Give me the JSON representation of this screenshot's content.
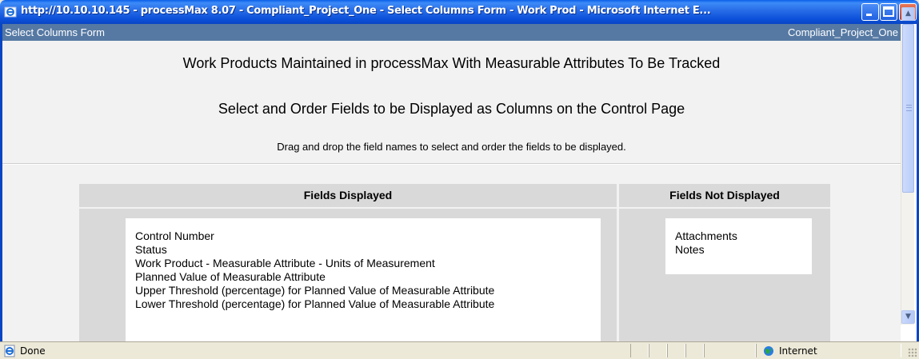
{
  "window": {
    "title": "http://10.10.10.145 - processMax 8.07 - Compliant_Project_One - Select Columns Form - Work Prod - Microsoft Internet E...",
    "controls": [
      "minimize",
      "maximize",
      "close"
    ]
  },
  "page_header": {
    "left": "Select Columns Form",
    "right": "Compliant_Project_One"
  },
  "content": {
    "heading": "Work Products Maintained in processMax With Measurable Attributes To Be Tracked",
    "subheading": "Select and Order Fields to be Displayed as Columns on the Control Page",
    "instructions": "Drag and drop the field names to select and order the fields to be displayed."
  },
  "columns": {
    "displayed": {
      "header": "Fields Displayed",
      "items": [
        "Control Number",
        "Status",
        "Work Product - Measurable Attribute - Units of Measurement",
        "Planned Value of Measurable Attribute",
        "Upper Threshold (percentage) for Planned Value of Measurable Attribute",
        "Lower Threshold (percentage) for Planned Value of Measurable Attribute"
      ]
    },
    "not_displayed": {
      "header": "Fields Not Displayed",
      "items": [
        "Attachments",
        "Notes"
      ]
    }
  },
  "statusbar": {
    "status": "Done",
    "zone": "Internet"
  },
  "colors": {
    "title_bar": "#0b50d9",
    "page_header": "#5679a3",
    "column_bg": "#d9d9d9",
    "content_bg": "#f2f2f2"
  }
}
